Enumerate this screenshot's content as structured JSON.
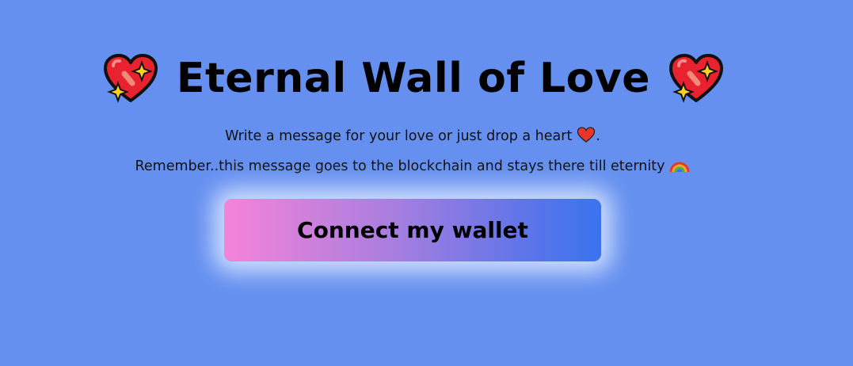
{
  "header": {
    "title": "Eternal Wall of Love",
    "left_icon": "sparkling-heart-icon",
    "right_icon": "sparkling-heart-icon"
  },
  "intro": {
    "line1": "Write a message for your love or just drop a heart",
    "line1_icon": "red-heart-icon",
    "line1_end": ".",
    "line2": "Remember..this message goes to the blockchain and stays there till eternity",
    "line2_icon": "rainbow-icon"
  },
  "wallet": {
    "connect_label": "Connect my wallet"
  },
  "colors": {
    "background": "#6590f0",
    "button_gradient_start": "#f583d8",
    "button_gradient_end": "#3a73ee",
    "button_glow": "#e1ebff"
  }
}
